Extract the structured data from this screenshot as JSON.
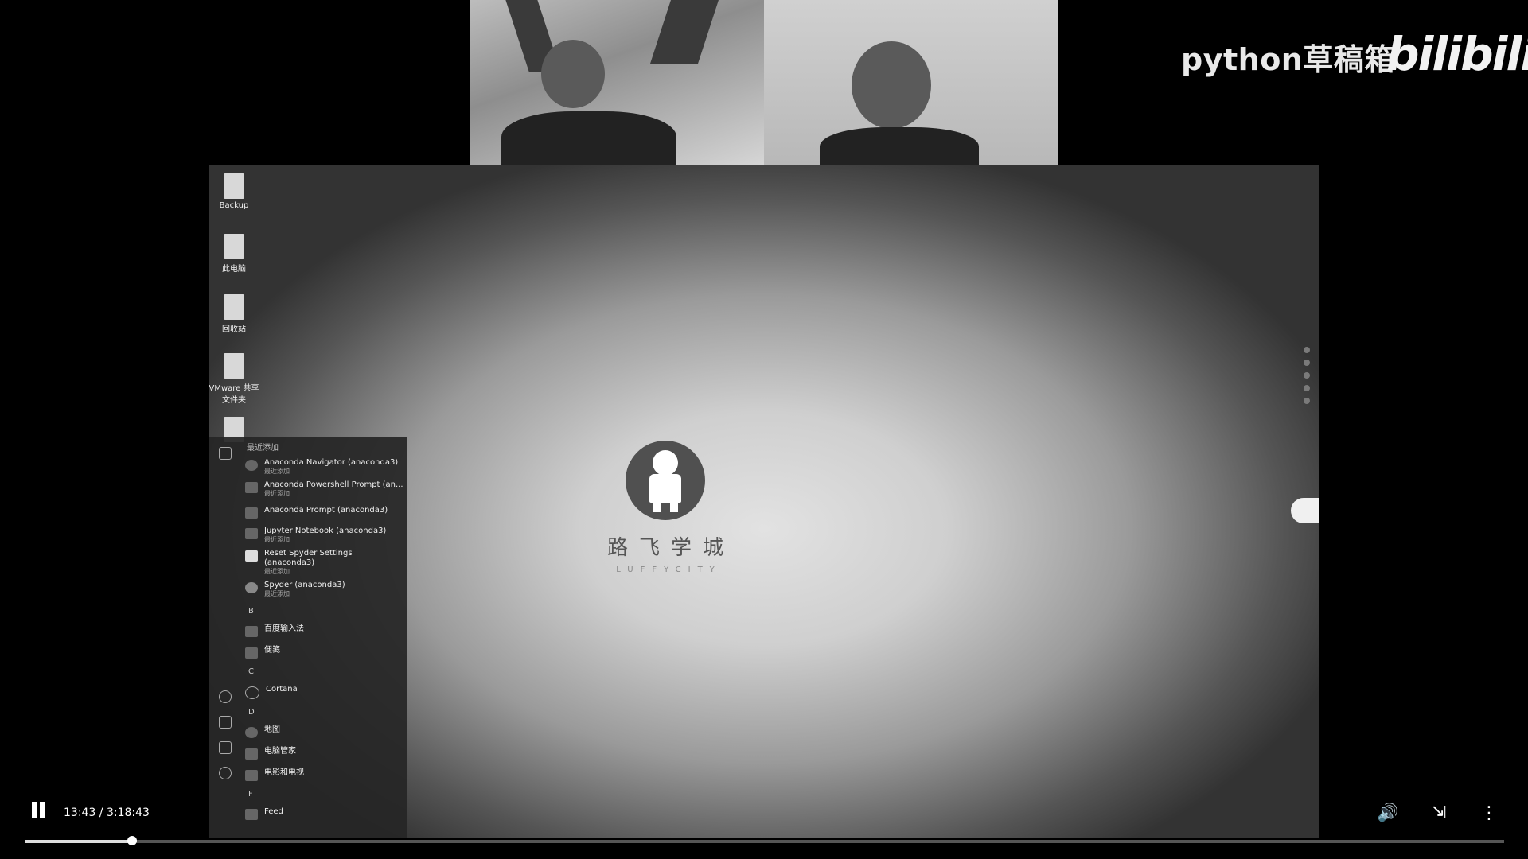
{
  "watermark": {
    "channel": "python草稿箱",
    "logo": "bilibili"
  },
  "desktop": {
    "icons": [
      {
        "label": "Backup"
      },
      {
        "label": "此电脑"
      },
      {
        "label": "回收站"
      },
      {
        "label": "VMware 共享文件夹"
      },
      {
        "label": ""
      }
    ],
    "brand": {
      "cn": "路飞学城",
      "en": "LUFFYCITY"
    }
  },
  "start_menu": {
    "recent_header": "最近添加",
    "recent_items": [
      {
        "label": "Anaconda Navigator (anaconda3)",
        "sub": "最近添加",
        "icon": "circle-icon"
      },
      {
        "label": "Anaconda Powershell Prompt (an...",
        "sub": "最近添加",
        "icon": "terminal-icon"
      },
      {
        "label": "Anaconda Prompt (anaconda3)",
        "sub": "",
        "icon": "terminal-icon"
      },
      {
        "label": "Jupyter Notebook (anaconda3)",
        "sub": "最近添加",
        "icon": "notebook-icon"
      },
      {
        "label": "Reset Spyder Settings (anaconda3)",
        "sub": "最近添加",
        "icon": "file-icon"
      },
      {
        "label": "Spyder (anaconda3)",
        "sub": "最近添加",
        "icon": "spider-icon"
      }
    ],
    "groups": [
      {
        "letter": "B",
        "items": [
          {
            "label": "百度输入法",
            "icon": "folder-icon"
          },
          {
            "label": "便笺",
            "icon": "note-icon"
          }
        ]
      },
      {
        "letter": "C",
        "items": [
          {
            "label": "Cortana",
            "icon": "circle-icon"
          }
        ]
      },
      {
        "letter": "D",
        "items": [
          {
            "label": "地图",
            "icon": "map-icon"
          },
          {
            "label": "电脑管家",
            "icon": "app-icon"
          },
          {
            "label": "电影和电视",
            "icon": "film-icon"
          }
        ]
      },
      {
        "letter": "F",
        "items": [
          {
            "label": "Feed",
            "icon": "app-icon"
          }
        ]
      }
    ]
  },
  "player": {
    "time": "13:43 / 3:18:43",
    "progress_fraction": 0.072,
    "icons": [
      "pause-icon",
      "volume-icon",
      "exit-fullscreen-icon",
      "more-icon"
    ]
  }
}
